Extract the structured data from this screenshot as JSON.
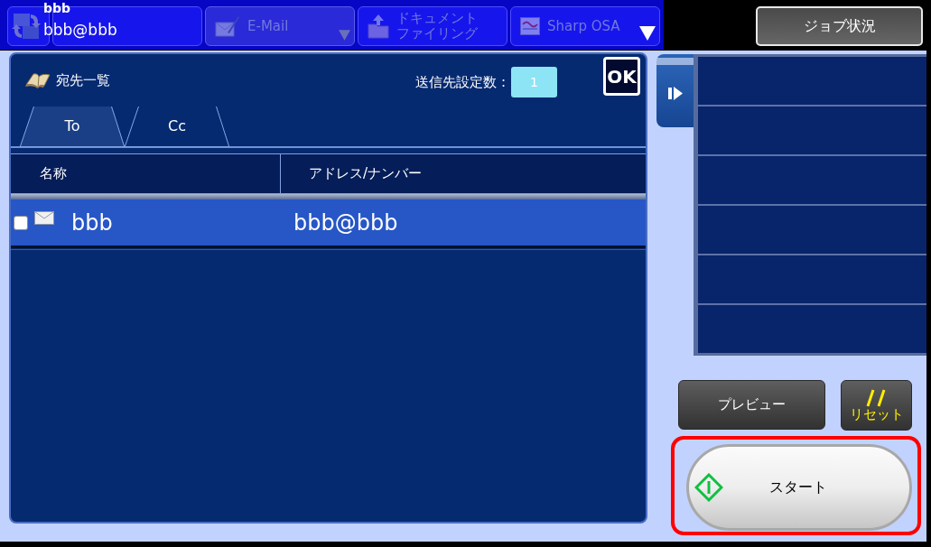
{
  "top_bar": {
    "sender": {
      "name": "bbb",
      "address": "bbb@bbb"
    },
    "mode_tabs": [
      {
        "kind": "copy",
        "selected": false,
        "dropdown": false
      },
      {
        "kind": "email",
        "label_lines": [
          "E-Mail"
        ],
        "selected": true,
        "dropdown": true
      },
      {
        "kind": "filing",
        "label_lines": [
          "ドキュメント",
          "ファイリング"
        ],
        "selected": false,
        "dropdown": false
      },
      {
        "kind": "osa",
        "label_lines": [
          "Sharp OSA"
        ],
        "selected": false,
        "dropdown": true
      }
    ],
    "job_status_button": "ジョブ状況"
  },
  "address_list": {
    "title": "宛先一覧",
    "count_label": "送信先設定数 :",
    "count": "1",
    "ok_button": "OK",
    "tabs": [
      {
        "label": "To",
        "selected": true
      },
      {
        "label": "Cc",
        "selected": false
      }
    ],
    "columns": [
      "名称",
      "アドレス/ナンバー"
    ],
    "rows": [
      {
        "name": "bbb",
        "address": "bbb@bbb",
        "checked": false,
        "selected": true
      }
    ]
  },
  "actions": {
    "preview_button": "プレビュー",
    "reset_button": "リセット",
    "start_button": {
      "label": "スタート",
      "highlighted": true
    }
  }
}
